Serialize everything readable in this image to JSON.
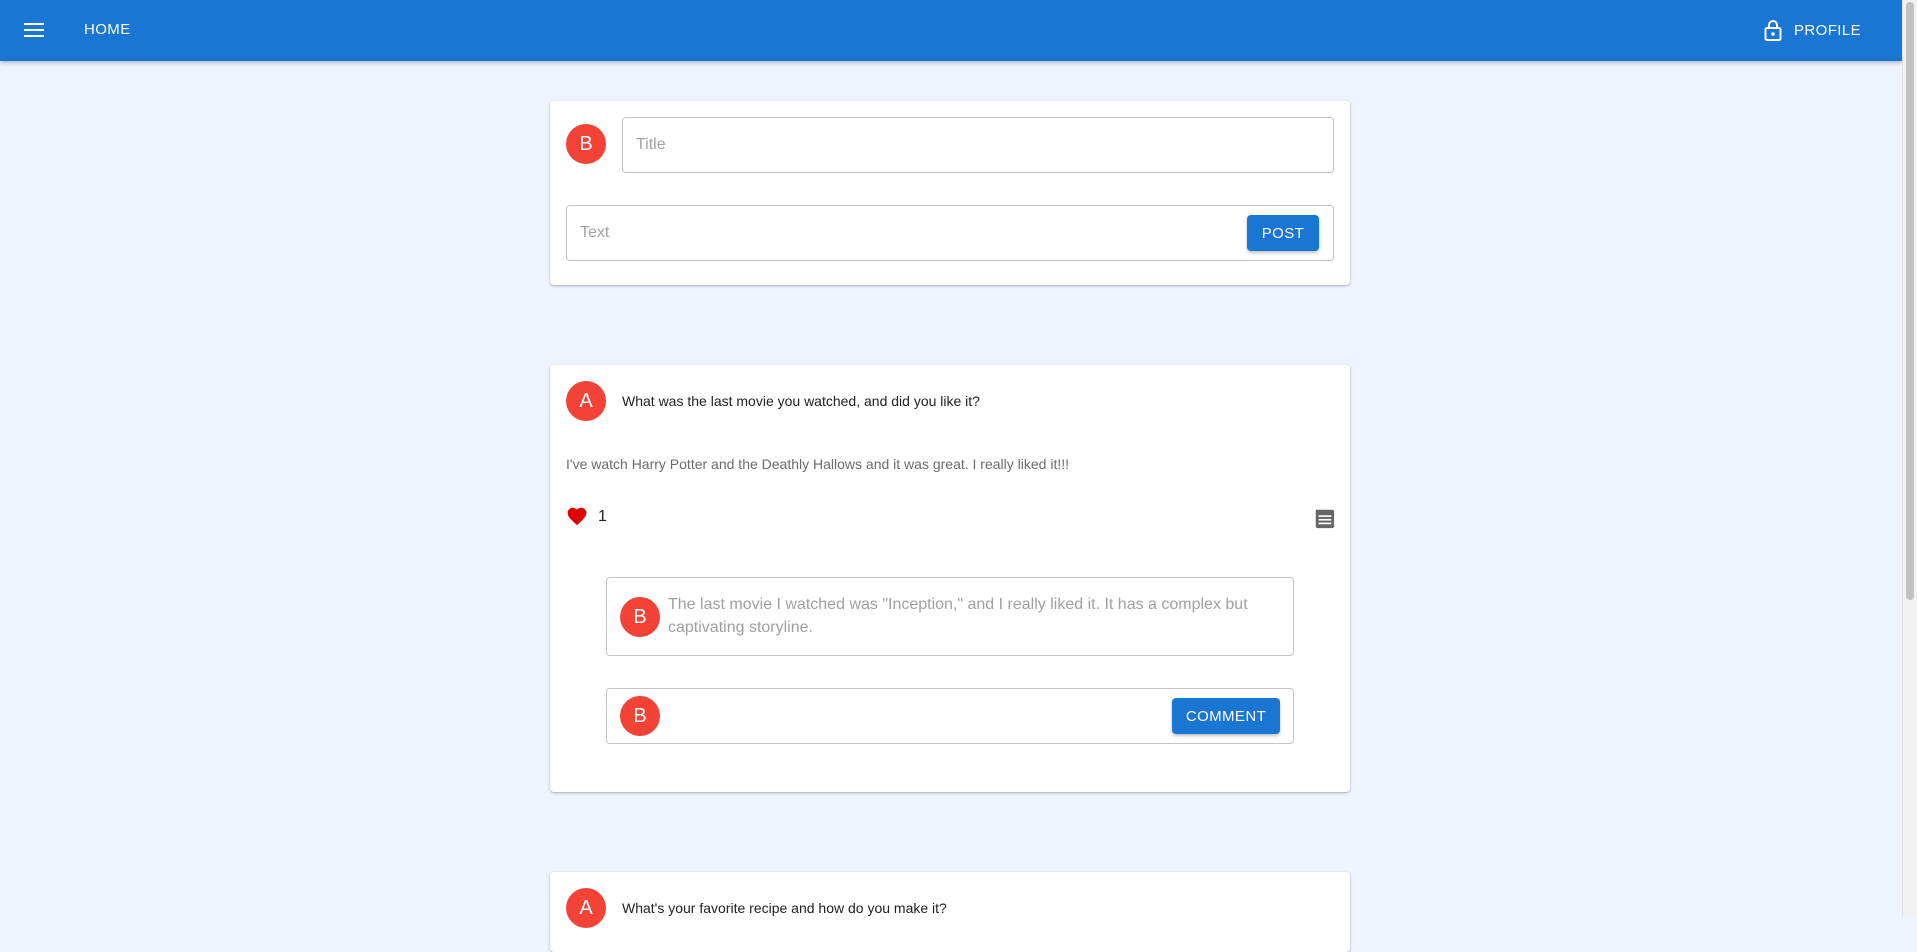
{
  "appbar": {
    "home_label": "HOME",
    "profile_label": "PROFILE",
    "menu_icon": "menu-icon",
    "lock_icon": "lock-icon"
  },
  "composer": {
    "avatar_letter": "B",
    "title_placeholder": "Title",
    "text_placeholder": "Text",
    "post_label": "POST"
  },
  "posts": [
    {
      "avatar_letter": "A",
      "title": "What was the last movie you watched, and did you like it?",
      "body": "I've watch Harry Potter and the Deathly Hallows and it was great. I really liked it!!!",
      "likes": "1",
      "comments": [
        {
          "avatar_letter": "B",
          "text": "The last movie I watched was \"Inception,\" and I really liked it. It has a complex but captivating storyline."
        }
      ],
      "comment_input": {
        "avatar_letter": "B",
        "button_label": "COMMENT"
      }
    },
    {
      "avatar_letter": "A",
      "title": "What's your favorite recipe and how do you make it?"
    }
  ],
  "colors": {
    "primary": "#1976d2",
    "avatar": "#f44336",
    "background": "#eef4fe",
    "like": "#e00000"
  }
}
